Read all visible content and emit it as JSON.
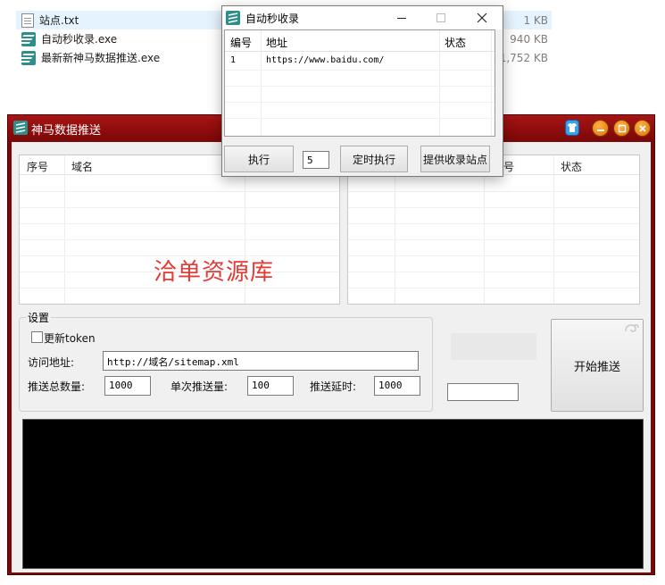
{
  "explorer": {
    "files": [
      {
        "name": "站点.txt",
        "size": "1 KB",
        "icon": "text-file-icon"
      },
      {
        "name": "自动秒收录.exe",
        "size": "940 KB",
        "icon": "app-icon"
      },
      {
        "name": "最新新神马数据推送.exe",
        "size": "1,752 KB",
        "icon": "app-icon"
      }
    ]
  },
  "main": {
    "title": "神马数据推送",
    "left_grid": {
      "headers": [
        "序号",
        "域名"
      ]
    },
    "right_grid": {
      "headers": [
        "号",
        "状态"
      ]
    },
    "watermark": "洽单资源库",
    "settings": {
      "legend": "设置",
      "update_token": "更新token",
      "url_label": "访问地址:",
      "url_value": "http://域名/sitemap.xml",
      "total_label": "推送总数量:",
      "total_value": "1000",
      "per_label": "单次推送量:",
      "per_value": "100",
      "delay_label": "推送延时:",
      "delay_value": "1000"
    },
    "start_button": "开始推送",
    "extra_input_value": ""
  },
  "popup": {
    "title": "自动秒收录",
    "headers": [
      "编号",
      "地址",
      "状态"
    ],
    "rows": [
      {
        "id": "1",
        "url": "https://www.baidu.com/",
        "status": ""
      }
    ],
    "execute_button": "执行",
    "interval_value": "5",
    "timed_button": "定时执行",
    "provide_button": "提供收录站点"
  },
  "colors": {
    "accent": "#a81414",
    "watermark": "#e53935"
  }
}
